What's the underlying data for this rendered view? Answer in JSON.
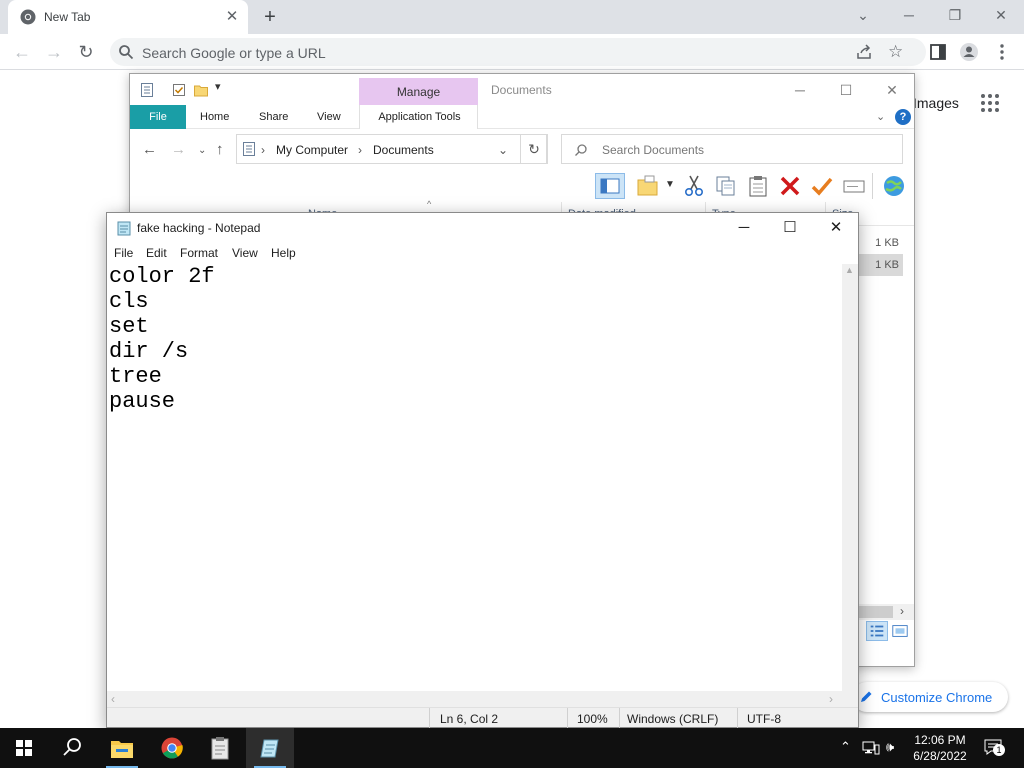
{
  "chrome": {
    "tab_title": "New Tab",
    "omnibox_placeholder": "Search Google or type a URL",
    "images_link": "Images",
    "customize_label": "Customize Chrome"
  },
  "explorer": {
    "title": "Documents",
    "manage_label": "Manage",
    "ribbon_tabs": [
      "File",
      "Home",
      "Share",
      "View",
      "Application Tools"
    ],
    "address": [
      "My Computer",
      "Documents"
    ],
    "search_placeholder": "Search Documents",
    "columns": [
      "Name",
      "Date modified",
      "Type",
      "Size"
    ],
    "sizes": [
      "1 KB",
      "1 KB"
    ]
  },
  "notepad": {
    "title": "fake hacking - Notepad",
    "menu": [
      "File",
      "Edit",
      "Format",
      "View",
      "Help"
    ],
    "lines": [
      "color 2f",
      "cls",
      "set",
      "dir /s",
      "tree",
      "pause"
    ],
    "status": {
      "position": "Ln 6, Col 2",
      "zoom": "100%",
      "line_ending": "Windows (CRLF)",
      "encoding": "UTF-8"
    }
  },
  "taskbar": {
    "time": "12:06 PM",
    "date": "6/28/2022",
    "notification_count": "1"
  }
}
